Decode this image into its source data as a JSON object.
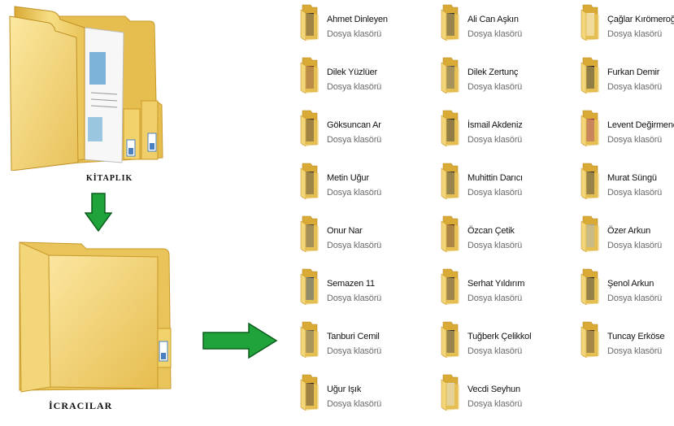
{
  "library": {
    "caption": "KİTAPLIK"
  },
  "performers": {
    "caption": "İCRACILAR"
  },
  "colors": {
    "arrow_green": "#1fa33a",
    "folder_yellow": "#f2d36b",
    "folder_dark": "#d9aa35"
  },
  "folder_type_label": "Dosya klasörü",
  "items": [
    {
      "name": "Ahmet Dinleyen",
      "type": "Dosya klasörü",
      "thumb": "#3a2a1a"
    },
    {
      "name": "Ali Can Aşkın",
      "type": "Dosya klasörü",
      "thumb": "#2b2b2b"
    },
    {
      "name": "Çağlar Kırömeroğlu",
      "type": "Dosya klasörü",
      "thumb": "#efe8d8"
    },
    {
      "name": "Dilek Yüzlüer",
      "type": "Dosya klasörü",
      "thumb": "#7a3a20"
    },
    {
      "name": "Dilek Zertunç",
      "type": "Dosya klasörü",
      "thumb": "#4a4a4a"
    },
    {
      "name": "Furkan Demir",
      "type": "Dosya klasörü",
      "thumb": "#1a1a1a"
    },
    {
      "name": "Göksuncan Ar",
      "type": "Dosya klasörü",
      "thumb": "#3d2616"
    },
    {
      "name": "İsmail Akdeniz",
      "type": "Dosya klasörü",
      "thumb": "#1b1b1b"
    },
    {
      "name": "Levent Değirmencioğlu",
      "type": "Dosya klasörü",
      "thumb": "#9a2a4a"
    },
    {
      "name": "Metin Uğur",
      "type": "Dosya klasörü",
      "thumb": "#3a2a20"
    },
    {
      "name": "Muhittin Darıcı",
      "type": "Dosya klasörü",
      "thumb": "#2a2a2a"
    },
    {
      "name": "Murat Süngü",
      "type": "Dosya klasörü",
      "thumb": "#2a2620"
    },
    {
      "name": "Onur Nar",
      "type": "Dosya klasörü",
      "thumb": "#4a4440"
    },
    {
      "name": "Özcan Çetik",
      "type": "Dosya klasörü",
      "thumb": "#5a2a1a"
    },
    {
      "name": "Özer Arkun",
      "type": "Dosya klasörü",
      "thumb": "#9aa0a8"
    },
    {
      "name": "Semazen 11",
      "type": "Dosya klasörü",
      "thumb": "#1e3a6a"
    },
    {
      "name": "Serhat Yıldırım",
      "type": "Dosya klasörü",
      "thumb": "#3a2a2a"
    },
    {
      "name": "Şenol Arkun",
      "type": "Dosya klasörü",
      "thumb": "#222222"
    },
    {
      "name": "Tanburi Cemil",
      "type": "Dosya klasörü",
      "thumb": "#55504a"
    },
    {
      "name": "Tuğberk Çelikkol",
      "type": "Dosya klasörü",
      "thumb": "#2a2a2a"
    },
    {
      "name": "Tuncay Erköse",
      "type": "Dosya klasörü",
      "thumb": "#4a3020"
    },
    {
      "name": "Uğur Işık",
      "type": "Dosya klasörü",
      "thumb": "#3a2418"
    },
    {
      "name": "Vecdi Seyhun",
      "type": "Dosya klasörü",
      "thumb": "#d8d4cc"
    }
  ]
}
